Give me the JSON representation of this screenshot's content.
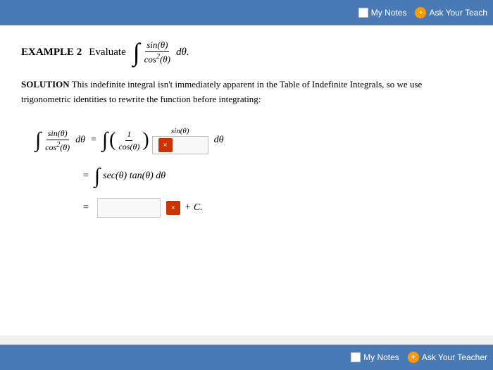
{
  "top_bar": {
    "notes_label": "My Notes",
    "ask_teacher_label": "Ask Your Teach"
  },
  "bottom_bar": {
    "notes_label": "My Notes",
    "ask_teacher_label": "Ask Your Teacher"
  },
  "content": {
    "example_label": "EXAMPLE 2",
    "evaluate_label": "Evaluate",
    "integral_expression": "∫ sin(θ) / cos²(θ) dθ",
    "solution_label": "SOLUTION",
    "solution_text": "This indefinite integral isn't immediately apparent in the Table of Indefinite Integrals, so we use trigonometric identities to rewrite the function before integrating:",
    "step1_equals": "=",
    "step2_equals": "=",
    "step3_equals": "=",
    "plus_c": "+ C.",
    "x_button_label": "×"
  },
  "icons": {
    "checkbox": "checkbox-icon",
    "ask": "ask-teacher-icon",
    "x_close": "x-close-icon"
  }
}
